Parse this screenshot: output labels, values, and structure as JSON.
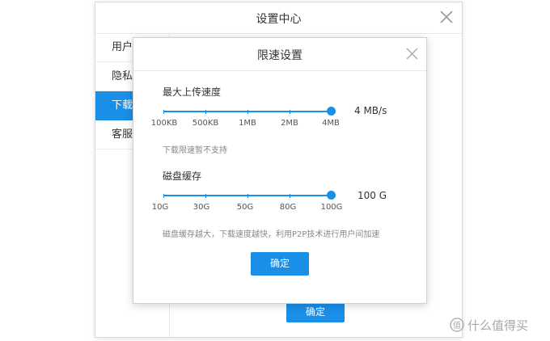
{
  "outer_window": {
    "title": "设置中心",
    "sidebar": [
      "用户",
      "隐私",
      "下载",
      "客服"
    ],
    "confirm_label": "确定"
  },
  "modal": {
    "title": "限速设置",
    "upload": {
      "label": "最大上传速度",
      "scale": [
        "100KB",
        "500KB",
        "1MB",
        "2MB",
        "4MB"
      ],
      "value_text": "4 MB/s",
      "selected_index": 4,
      "note": "下载限速暂不支持"
    },
    "cache": {
      "label": "磁盘缓存",
      "scale": [
        "10G",
        "30G",
        "50G",
        "80G",
        "100G"
      ],
      "value_text": "100 G",
      "selected_index": 4,
      "note": "磁盘缓存越大，下载速度越快，利用P2P技术进行用户间加速"
    },
    "confirm_label": "确定"
  },
  "watermark": "什么值得买",
  "colors": {
    "accent": "#1a8fe8"
  }
}
